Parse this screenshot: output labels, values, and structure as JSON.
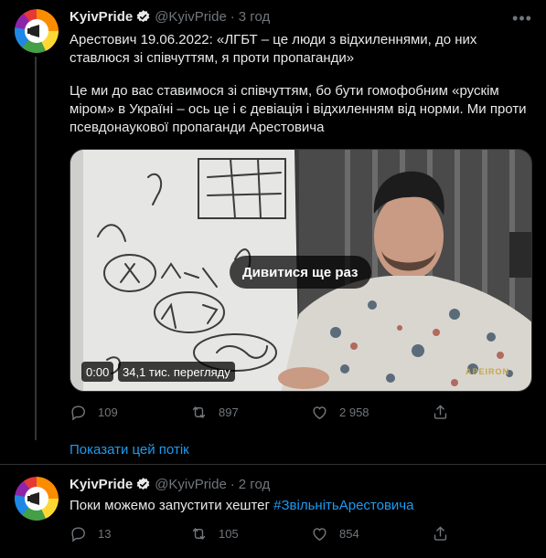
{
  "tweets": [
    {
      "author": {
        "name": "KyivPride",
        "handle": "@KyivPride",
        "separator": "·",
        "time": "3 год"
      },
      "text_line1": "Арестович 19.06.2022: «ЛГБТ – це люди з відхиленнями, до них ставлюся зі співчуттям, я проти пропаганди»",
      "text_line2": "Це ми до вас ставимося зі співчуттям, бо бути гомофобним «рускім міром» в Україні – ось це і є девіація і відхиленням від норми. Ми проти псевдонаукової пропаганди Арестовича",
      "video": {
        "replay_label": "Дивитися ще раз",
        "timestamp": "0:00",
        "views": "34,1 тис. перегляду",
        "watermark": "APEIRON"
      },
      "stats": {
        "replies": "109",
        "retweets": "897",
        "likes": "2 958"
      }
    },
    {
      "author": {
        "name": "KyivPride",
        "handle": "@KyivPride",
        "separator": "·",
        "time": "2 год"
      },
      "text_prefix": "Поки можемо запустити хештег ",
      "hashtag": "#ЗвільнітьАрестовича",
      "stats": {
        "replies": "13",
        "retweets": "105",
        "likes": "854"
      }
    }
  ],
  "show_thread_label": "Показати цей потік",
  "colors": {
    "accent": "#1d9bf0",
    "muted": "#71767b",
    "background": "#000000",
    "text": "#e7e9ea"
  },
  "icons": [
    "more-icon",
    "verified-icon",
    "reply-icon",
    "retweet-icon",
    "like-icon",
    "share-icon"
  ]
}
